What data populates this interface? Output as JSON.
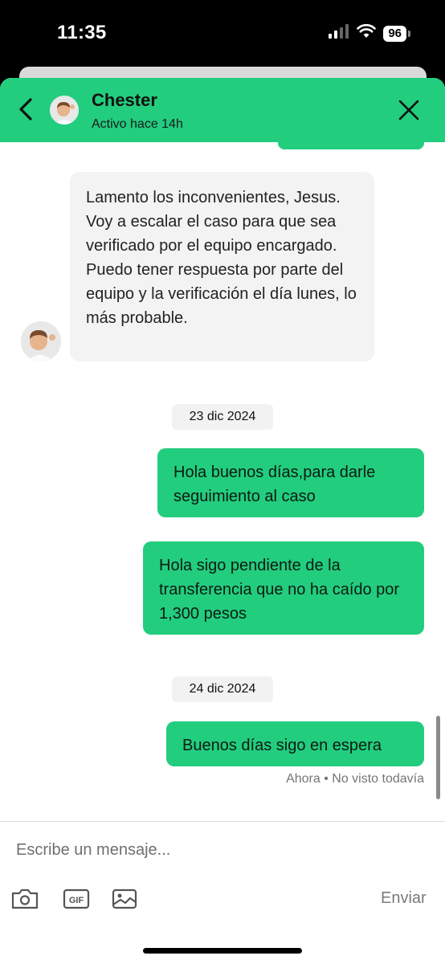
{
  "status_bar": {
    "time": "11:35",
    "battery": "96"
  },
  "header": {
    "name": "Chester",
    "status": "Activo hace 14h"
  },
  "messages": {
    "incoming": "Lamento los inconvenientes, Jesus. Voy a escalar el caso para que sea verificado por el equipo encargado. Puedo tener respuesta por parte del equipo y la verificación el día lunes, lo más probable.",
    "date1": "23 dic 2024",
    "out1": "Hola buenos días,para darle seguimiento al caso",
    "out2": "Hola sigo pendiente de la transferencia que no ha caído por 1,300 pesos",
    "date2": "24 dic 2024",
    "out3": "Buenos días sigo en espera",
    "receipt": "Ahora • No visto todavía"
  },
  "composer": {
    "placeholder": "Escribe un mensaje...",
    "send_label": "Enviar",
    "gif_label": "GIF"
  },
  "colors": {
    "accent": "#22cd7e",
    "incoming_bubble": "#f3f3f3"
  },
  "icons": [
    "back-icon",
    "close-icon",
    "camera-icon",
    "gif-icon",
    "image-icon",
    "signal-icon",
    "wifi-icon",
    "battery-icon"
  ]
}
